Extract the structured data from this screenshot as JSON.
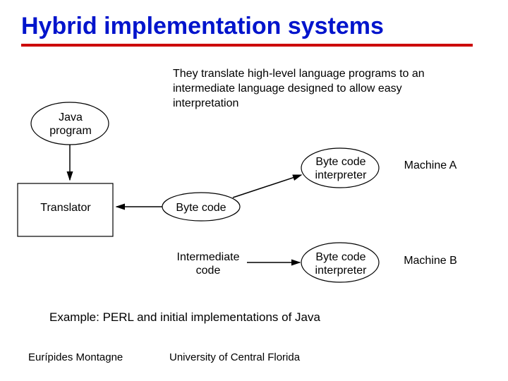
{
  "title": "Hybrid implementation systems",
  "description": "They translate high-level language programs to an intermediate language designed to allow easy interpretation",
  "nodes": {
    "java_program": "Java\nprogram",
    "translator": "Translator",
    "byte_code": "Byte code",
    "intermediate_code": "Intermediate\ncode",
    "interpreter_a": "Byte code\ninterpreter",
    "interpreter_b": "Byte code\ninterpreter",
    "machine_a": "Machine A",
    "machine_b": "Machine B"
  },
  "example": "Example: PERL and initial implementations of Java",
  "footer": {
    "author": "Eurípides Montagne",
    "institution": "University of Central Florida"
  }
}
